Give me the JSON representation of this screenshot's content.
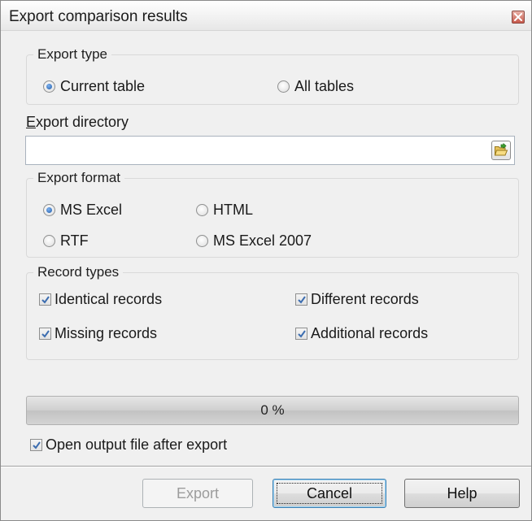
{
  "window": {
    "title": "Export comparison results"
  },
  "export_type": {
    "legend": "Export type",
    "options": [
      {
        "label": "Current table",
        "checked": true
      },
      {
        "label": "All tables",
        "checked": false
      }
    ]
  },
  "export_directory": {
    "label_mnemonic": "E",
    "label_rest": "xport directory",
    "value": "",
    "browse_icon": "folder-open-icon"
  },
  "export_format": {
    "legend": "Export format",
    "options": [
      {
        "label": "MS Excel",
        "checked": true
      },
      {
        "label": "HTML",
        "checked": false
      },
      {
        "label": "RTF",
        "checked": false
      },
      {
        "label": "MS Excel 2007",
        "checked": false
      }
    ]
  },
  "record_types": {
    "legend": "Record types",
    "options": [
      {
        "label": "Identical records",
        "checked": true
      },
      {
        "label": "Different records",
        "checked": true
      },
      {
        "label": "Missing records",
        "checked": true
      },
      {
        "label": "Additional records",
        "checked": true
      }
    ]
  },
  "progress": {
    "value_fraction": 0,
    "text": "0 %"
  },
  "open_after_export": {
    "label": "Open output file after export",
    "checked": true
  },
  "buttons": {
    "export": {
      "label": "Export",
      "enabled": false
    },
    "cancel": {
      "label": "Cancel",
      "enabled": true,
      "default": true
    },
    "help": {
      "label": "Help",
      "enabled": true
    }
  },
  "colors": {
    "check_mark": "#3c6db0",
    "radio_dot": "#1f5aa8",
    "close_button": "#c7584a"
  }
}
